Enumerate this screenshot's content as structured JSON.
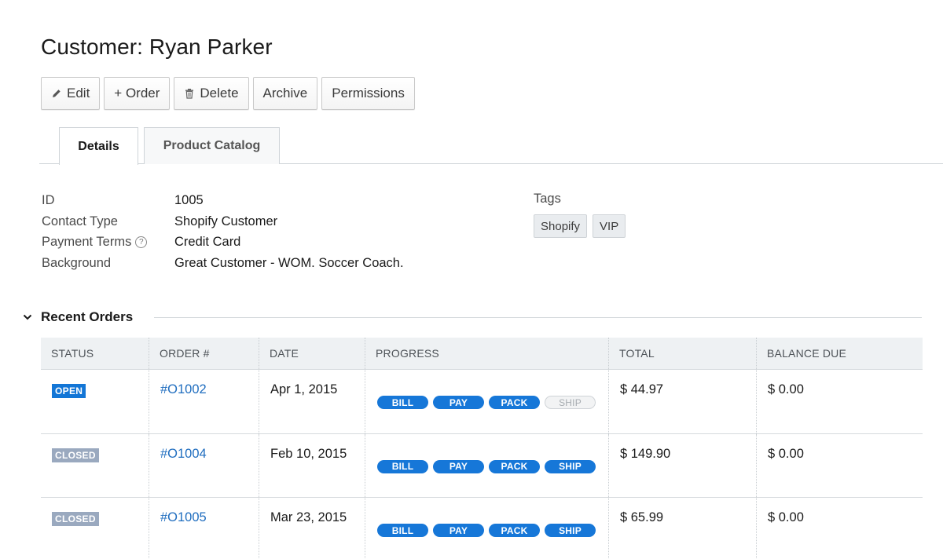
{
  "page": {
    "title": "Customer: Ryan Parker"
  },
  "toolbar": {
    "edit_label": "Edit",
    "order_label": "+ Order",
    "delete_label": "Delete",
    "archive_label": "Archive",
    "permissions_label": "Permissions"
  },
  "tabs": [
    {
      "label": "Details",
      "active": true
    },
    {
      "label": "Product Catalog",
      "active": false
    }
  ],
  "details": [
    {
      "label": "ID",
      "value": "1005"
    },
    {
      "label": "Contact Type",
      "value": "Shopify Customer"
    },
    {
      "label": "Payment Terms",
      "value": "Credit Card"
    },
    {
      "label": "Background",
      "value": "Great Customer - WOM. Soccer Coach."
    }
  ],
  "tags": {
    "label": "Tags",
    "items": [
      "Shopify",
      "VIP"
    ]
  },
  "recent_orders": {
    "title": "Recent Orders",
    "columns": [
      "STATUS",
      "ORDER #",
      "DATE",
      "PROGRESS",
      "TOTAL",
      "BALANCE DUE"
    ],
    "progress_steps": [
      "BILL",
      "PAY",
      "PACK",
      "SHIP"
    ],
    "rows": [
      {
        "status": "OPEN",
        "order": "#O1002",
        "date": "Apr 1, 2015",
        "total": "$ 44.97",
        "balance": "$ 0.00",
        "completed_steps": 3
      },
      {
        "status": "CLOSED",
        "order": "#O1004",
        "date": "Feb 10, 2015",
        "total": "$ 149.90",
        "balance": "$ 0.00",
        "completed_steps": 4
      },
      {
        "status": "CLOSED",
        "order": "#O1005",
        "date": "Mar 23, 2015",
        "total": "$ 65.99",
        "balance": "$ 0.00",
        "completed_steps": 4
      }
    ]
  },
  "colors": {
    "accent": "#1677d8",
    "status_open": "#1376d6",
    "status_closed": "#9aa9bf",
    "link": "#1f6dbf"
  },
  "icons": {
    "edit": "pencil-icon",
    "delete": "trash-icon",
    "help": "help-icon",
    "collapse": "chevron-down-icon"
  }
}
